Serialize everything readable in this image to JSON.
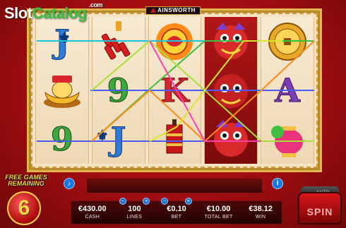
{
  "watermark": {
    "slot": "Slot",
    "catalog": "Catalog",
    "com": ".com"
  },
  "brand": {
    "name": "AINSWORTH"
  },
  "reels": [
    [
      "J",
      "gold-ingot-icon",
      "9"
    ],
    [
      "firecracker-icon",
      "9",
      "J"
    ],
    [
      "dragon-coin-icon",
      "K",
      "firecracker-bundle-icon"
    ],
    [
      "lion-dance-icon",
      "lion-dance-icon",
      "lion-dance-icon"
    ],
    [
      "gold-coin-icon",
      "A",
      "lantern-icon"
    ]
  ],
  "free_games": {
    "title_line1": "FREE GAMES",
    "title_line2": "REMAINING",
    "count": "6"
  },
  "panel": {
    "cash_value": "€430.00",
    "cash_label": "CASH",
    "lines_value": "100",
    "lines_label": "LINES",
    "bet_value": "€0.10",
    "bet_label": "BET",
    "total_value": "€10.00",
    "total_label": "TOTAL BET",
    "win_value": "€38.12",
    "win_label": "WIN",
    "minus": "−",
    "plus": "+"
  },
  "spin": {
    "auto_label": "AUTO",
    "spin_label": "SPIN"
  },
  "buttons": {
    "info": "i",
    "sound": "♪"
  },
  "colors": {
    "frame_gold": "#e3b64c",
    "bg_red": "#9c0d10",
    "j_blue": "#2f7bd6",
    "nine_green": "#3fa53f",
    "k_red": "#d8262e",
    "a_purple": "#7d3fb5"
  }
}
